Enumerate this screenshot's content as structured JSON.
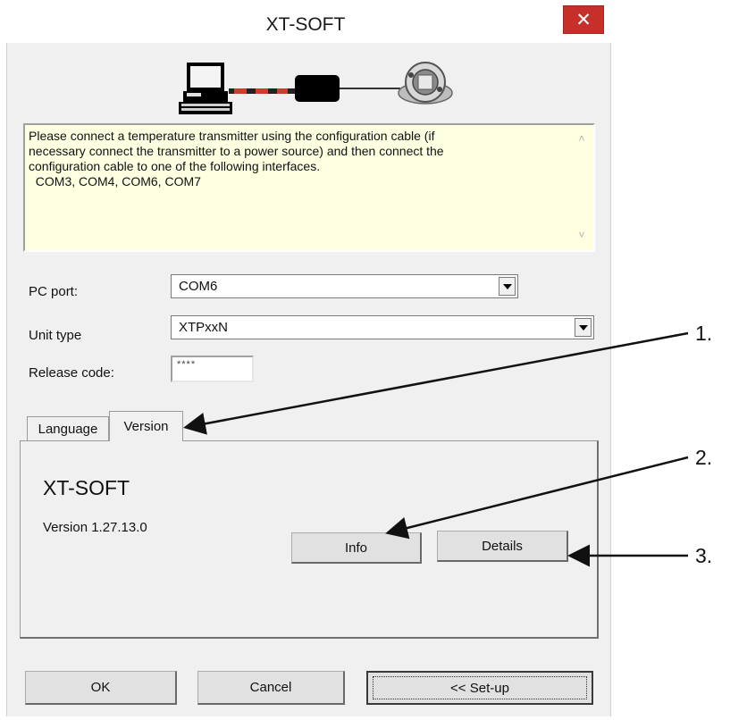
{
  "window": {
    "title": "XT-SOFT",
    "close_symbol": "✕"
  },
  "message": {
    "text": "Please connect a temperature transmitter using the configuration cable (if\nnecessary connect the transmitter to a power source) and then connect the\nconfiguration cable to one of the following interfaces.\n  COM3, COM4, COM6, COM7"
  },
  "form": {
    "pc_port": {
      "label": "PC port:",
      "value": "COM6"
    },
    "unit_type": {
      "label": "Unit type",
      "value": "XTPxxN"
    },
    "release_code": {
      "label": "Release code:",
      "value": "****"
    }
  },
  "tabs": [
    {
      "label": "Language",
      "selected": false
    },
    {
      "label": "Version",
      "selected": true
    }
  ],
  "version_tab": {
    "heading": "XT-SOFT",
    "version_text": "Version 1.27.13.0",
    "info_button": "Info",
    "details_button": "Details"
  },
  "footer": {
    "ok_button": "OK",
    "cancel_button": "Cancel",
    "setup_button": "<< Set-up"
  },
  "annotations": [
    "1.",
    "2.",
    "3."
  ],
  "colors": {
    "close_button": "#c7302a",
    "message_background": "#ffffe1",
    "dialog_background": "#f0f0f0"
  }
}
